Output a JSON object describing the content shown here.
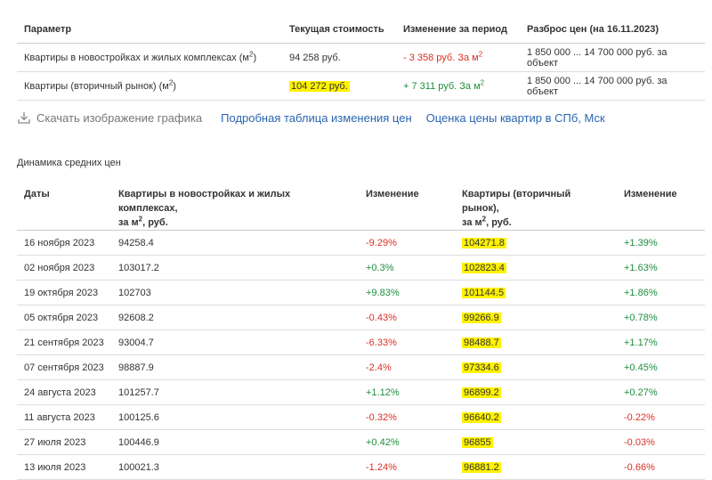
{
  "summary": {
    "headers": {
      "param": "Параметр",
      "current": "Текущая стоимость",
      "change": "Изменение за период",
      "range": "Разброс цен (на 16.11.2023)"
    },
    "rows": [
      {
        "param": "Квартиры в новостройках и жилых комплексах (м",
        "param_sup": "2",
        "param_tail": ")",
        "current": "94 258 руб.",
        "change": "- 3 358 руб. За м",
        "change_sup": "2",
        "range": "1 850 000 ... 14 700 000 руб. за объект"
      },
      {
        "param": "Квартиры (вторичный рынок) (м",
        "param_sup": "2",
        "param_tail": ")",
        "current": "104 272 руб.",
        "change": "+ 7 311 руб. За м",
        "change_sup": "2",
        "range": "1 850 000 ... 14 700 000 руб. за объект"
      }
    ]
  },
  "links": {
    "download": "Скачать изображение графика",
    "table": "Подробная таблица изменения цен",
    "estimate": "Оценка цены квартир в СПб, Мск"
  },
  "dynamics": {
    "title": "Динамика средних цен",
    "headers": {
      "date": "Даты",
      "new_l1": "Квартиры в новостройках и жилых комплексах,",
      "new_l2a": "за м",
      "new_sup": "2",
      "new_l2b": ", руб.",
      "change1": "Изменение",
      "sec_l1": "Квартиры (вторичный рынок),",
      "sec_l2a": "за м",
      "sec_sup": "2",
      "sec_l2b": ", руб.",
      "change2": "Изменение"
    },
    "rows": [
      {
        "date": "16 ноября 2023",
        "new_price": "94258.4",
        "new_change": "-9.29%",
        "sec_price": "104271.8",
        "sec_change": "+1.39%"
      },
      {
        "date": "02 ноября 2023",
        "new_price": "103017.2",
        "new_change": "+0.3%",
        "sec_price": "102823.4",
        "sec_change": "+1.63%"
      },
      {
        "date": "19 октября 2023",
        "new_price": "102703",
        "new_change": "+9.83%",
        "sec_price": "101144.5",
        "sec_change": "+1.86%"
      },
      {
        "date": "05 октября 2023",
        "new_price": "92608.2",
        "new_change": "-0.43%",
        "sec_price": "99266.9",
        "sec_change": "+0.78%"
      },
      {
        "date": "21 сентября 2023",
        "new_price": "93004.7",
        "new_change": "-6.33%",
        "sec_price": "98488.7",
        "sec_change": "+1.17%"
      },
      {
        "date": "07 сентября 2023",
        "new_price": "98887.9",
        "new_change": "-2.4%",
        "sec_price": "97334.6",
        "sec_change": "+0.45%"
      },
      {
        "date": "24 августа 2023",
        "new_price": "101257.7",
        "new_change": "+1.12%",
        "sec_price": "96899.2",
        "sec_change": "+0.27%"
      },
      {
        "date": "11 августа 2023",
        "new_price": "100125.6",
        "new_change": "-0.32%",
        "sec_price": "96640.2",
        "sec_change": "-0.22%"
      },
      {
        "date": "27 июля 2023",
        "new_price": "100446.9",
        "new_change": "+0.42%",
        "sec_price": "96855",
        "sec_change": "-0.03%"
      },
      {
        "date": "13 июля 2023",
        "new_price": "100021.3",
        "new_change": "-1.24%",
        "sec_price": "96881.2",
        "sec_change": "-0.66%"
      }
    ]
  },
  "colors": {
    "highlight": "#fff200",
    "negative": "#d93025",
    "positive": "#1e8e3e",
    "link": "#2a66b0"
  }
}
